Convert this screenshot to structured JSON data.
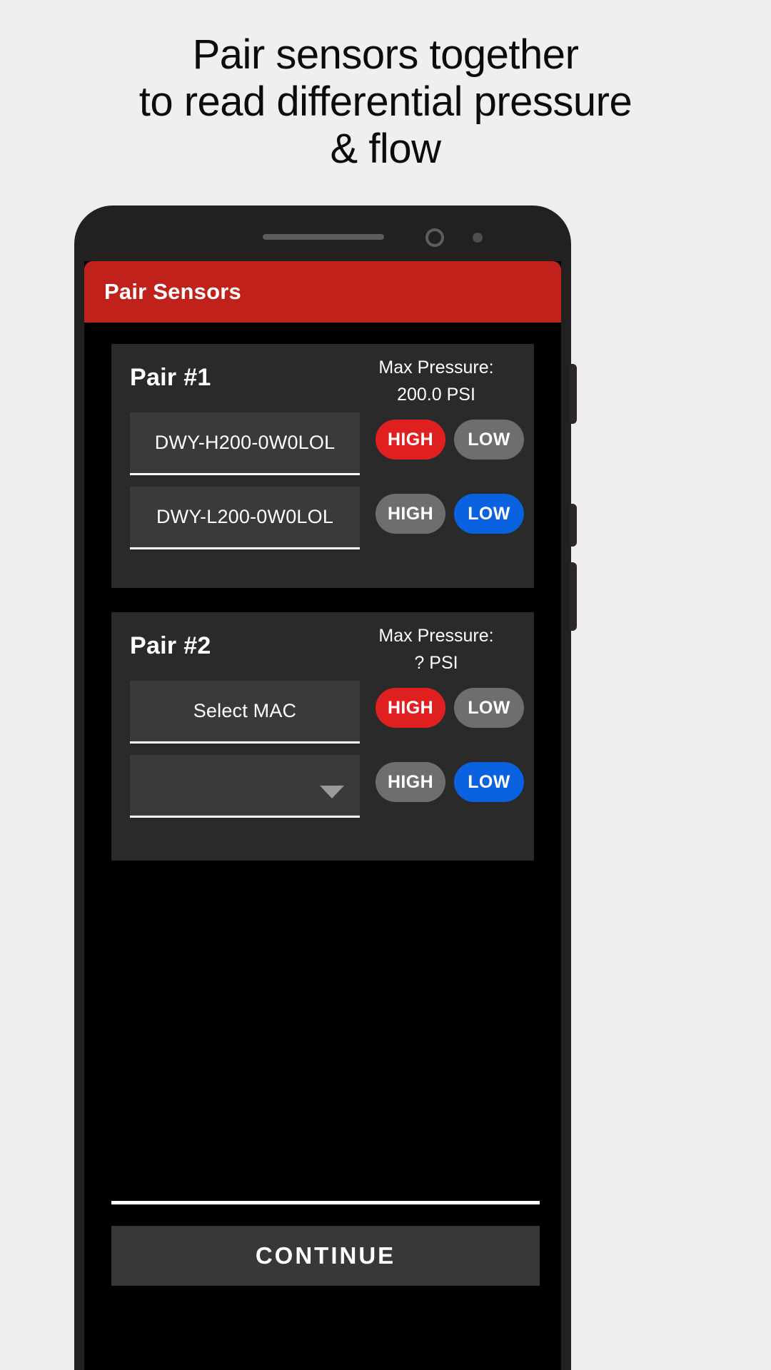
{
  "headline": {
    "line1": "Pair sensors together",
    "line2": "to read differential pressure",
    "line3": "& flow"
  },
  "app": {
    "appbar_title": "Pair Sensors",
    "accent_red": "#c0211b",
    "active_high_color": "#e02020",
    "active_low_color": "#0a62e0",
    "inactive_color": "#6e6e6e",
    "card_bg": "#2a2a2a",
    "screen_bg": "#000000"
  },
  "pairs": [
    {
      "title": "Pair #1",
      "max_pressure_label": "Max Pressure:",
      "max_pressure_value": "200.0  PSI",
      "rows": [
        {
          "mac": "DWY-H200-0W0LOL",
          "high_label": "HIGH",
          "low_label": "LOW",
          "selected": "HIGH"
        },
        {
          "mac": "DWY-L200-0W0LOL",
          "high_label": "HIGH",
          "low_label": "LOW",
          "selected": "LOW"
        }
      ]
    },
    {
      "title": "Pair #2",
      "max_pressure_label": "Max Pressure:",
      "max_pressure_value": "?  PSI",
      "rows": [
        {
          "mac": "Select MAC",
          "high_label": "HIGH",
          "low_label": "LOW",
          "selected": "HIGH"
        },
        {
          "mac": "",
          "high_label": "HIGH",
          "low_label": "LOW",
          "selected": "LOW"
        }
      ]
    }
  ],
  "footer": {
    "continue_label": "CONTINUE"
  }
}
